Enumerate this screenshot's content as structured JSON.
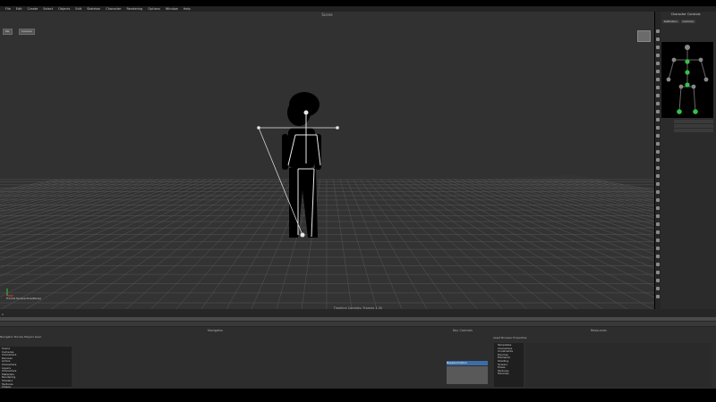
{
  "menubar": {
    "items": [
      "File",
      "Edit",
      "Create",
      "Select",
      "Objects",
      "Edit",
      "Skeleton",
      "Character",
      "Rendering",
      "Options",
      "Window",
      "Help"
    ]
  },
  "viewport": {
    "title": "Scene",
    "buttons": [
      "Per",
      "Camera"
    ],
    "projection_label": "Frontal Perspective(Persp)"
  },
  "right_panel": {
    "title": "Character Controls",
    "tabs": [
      "Definition",
      "Controls"
    ]
  },
  "timeline": {
    "label": "Timeline Controls: Frames 1-30",
    "start": "1"
  },
  "bottom": {
    "navigator": {
      "title": "Navigator",
      "tabs": [
        "Navigator",
        "Stories",
        "Players",
        "Gear",
        "Animation Triggers"
      ],
      "tree": [
        "Scene",
        "Cameras",
        "Characters",
        "Devices",
        "Actors",
        "Characters",
        "Layers",
        "Characters",
        "Materials",
        "Rendering",
        "Shaders",
        "Textures",
        "Videos",
        "Takes"
      ]
    },
    "key_controls": {
      "title": "Key Controls",
      "layer": "BaseAnimation"
    },
    "resources": {
      "title": "Resources",
      "tabs": [
        "Asset Browser",
        "Properties",
        "Filters",
        "Pose Controls",
        "Groups",
        "Sets"
      ],
      "tree": [
        "Templates",
        "Characters",
        "Constraints",
        "Devices",
        "Elements",
        "Shading",
        "Solvers",
        "Poses",
        "Textures",
        "Tutorials"
      ]
    }
  },
  "colors": {
    "viewport_bg": "#313131",
    "panel_bg": "#2d2d2d",
    "skeleton_green": "#34c24a"
  }
}
